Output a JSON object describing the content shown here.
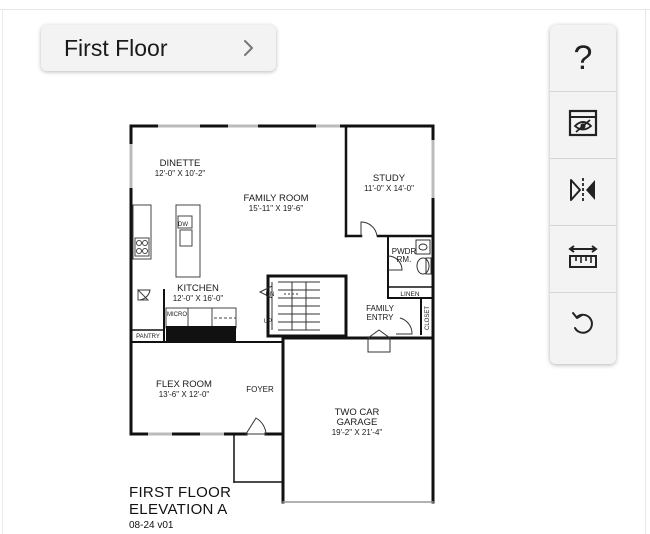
{
  "floor_selector": {
    "label": "First Floor"
  },
  "toolbar": {
    "tools": [
      {
        "name": "help",
        "glyph": "?"
      },
      {
        "name": "hide-furniture"
      },
      {
        "name": "mirror"
      },
      {
        "name": "measure"
      },
      {
        "name": "reset"
      }
    ]
  },
  "plan": {
    "rooms": {
      "dinette": {
        "name": "DINETTE",
        "dims": "12'-0\" X 10'-2\""
      },
      "family_room": {
        "name": "FAMILY ROOM",
        "dims": "15'-11\" X 19'-6\""
      },
      "study": {
        "name": "STUDY",
        "dims": "11'-0\" X 14'-0\""
      },
      "kitchen": {
        "name": "KITCHEN",
        "dims": "12'-0\" X 16'-0\""
      },
      "flex_room": {
        "name": "FLEX ROOM",
        "dims": "13'-6\" X 12'-0\""
      },
      "garage": {
        "name1": "TWO CAR",
        "name2": "GARAGE",
        "dims": "19'-2\" X 21'-4\""
      }
    },
    "labels": {
      "dw": "DW",
      "pwdr1": "PWDR",
      "pwdr2": "RM.",
      "linen": "LINEN",
      "family_entry1": "FAMILY",
      "family_entry2": "ENTRY",
      "closet": "CLOSET",
      "dn": "DN",
      "up": "UP",
      "micro": "MICRO",
      "pantry": "PANTRY",
      "foyer": "FOYER"
    }
  },
  "caption": {
    "line1": "FIRST FLOOR",
    "line2": "ELEVATION A",
    "version": "08-24 v01"
  }
}
